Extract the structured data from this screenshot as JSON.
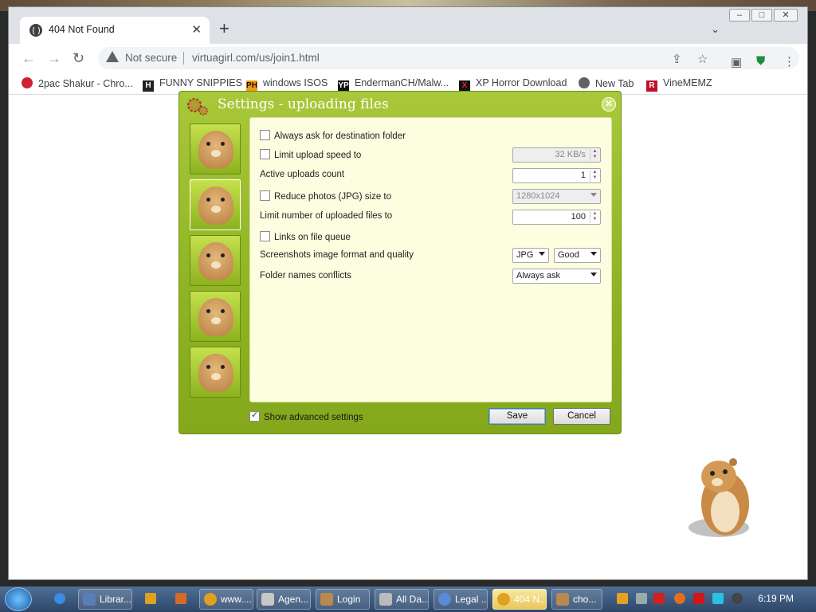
{
  "browser": {
    "tab_title": "404 Not Found",
    "security_label": "Not secure",
    "url": "virtuagirl.com/us/join1.html",
    "bookmarks": [
      {
        "label": "2pac Shakur - Chro...",
        "icon": "bookmark-icon"
      },
      {
        "label": "FUNNY SNIPPIES",
        "icon": "H-icon"
      },
      {
        "label": "windows ISOS",
        "icon": "PH-icon"
      },
      {
        "label": "EndermanCH/Malw...",
        "icon": "YP-icon"
      },
      {
        "label": "XP Horror Download",
        "icon": "X-icon"
      },
      {
        "label": "New Tab",
        "icon": "globe-icon"
      },
      {
        "label": "VineMEMZ",
        "icon": "R-icon"
      }
    ]
  },
  "dialog": {
    "title": "Settings - uploading files",
    "options": {
      "always_ask_folder": {
        "label": "Always ask for destination folder",
        "checked": false
      },
      "limit_speed": {
        "label": "Limit upload speed to",
        "checked": false,
        "value": "32 KB/s"
      },
      "active_uploads": {
        "label": "Active uploads count",
        "value": "1"
      },
      "reduce_photos": {
        "label": "Reduce photos (JPG) size to",
        "checked": false,
        "value": "1280x1024"
      },
      "limit_files": {
        "label": "Limit number of uploaded files to",
        "value": "100"
      },
      "links_on_queue": {
        "label": "Links on file queue",
        "checked": false
      },
      "screenshots_format": {
        "label": "Screenshots image format and quality",
        "format": "JPG",
        "quality": "Good"
      },
      "folder_conflicts": {
        "label": "Folder names conflicts",
        "value": "Always ask"
      }
    },
    "show_advanced": {
      "label": "Show advanced settings",
      "checked": true
    },
    "save_label": "Save",
    "cancel_label": "Cancel"
  },
  "taskbar": {
    "items": [
      {
        "label": "Librar...",
        "color": "#5a7db8"
      },
      {
        "label": "www....",
        "color": "#e0a020"
      },
      {
        "label": "Agen...",
        "color": "#c8c8c8"
      },
      {
        "label": "Login",
        "color": "#b88a50"
      },
      {
        "label": "All Da...",
        "color": "#bbbbbb"
      },
      {
        "label": "Legal ...",
        "color": "#5a8ad8"
      },
      {
        "label": "404 N...",
        "color": "#e0a020"
      },
      {
        "label": "cho...",
        "color": "#b88a50"
      }
    ],
    "clock": "6:19 PM"
  }
}
